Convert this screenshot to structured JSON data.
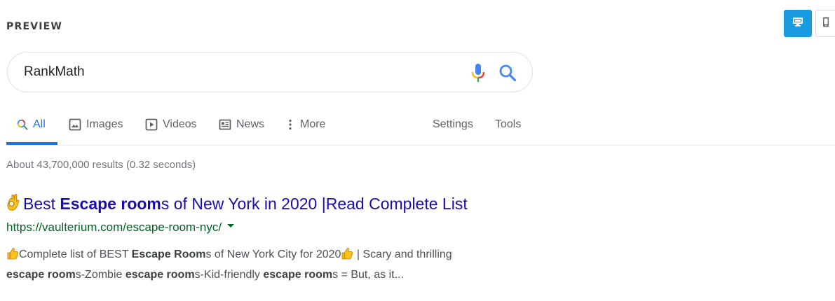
{
  "preview": {
    "label": "PREVIEW"
  },
  "device_toggle": {
    "desktop_icon": "desktop-icon",
    "mobile_icon": "mobile-icon",
    "active": "desktop"
  },
  "search": {
    "query": "RankMath",
    "mic_icon": "mic-icon",
    "search_icon": "search-icon"
  },
  "tabs": [
    {
      "label": "All",
      "icon": "search-icon",
      "active": true
    },
    {
      "label": "Images",
      "icon": "image-icon",
      "active": false
    },
    {
      "label": "Videos",
      "icon": "play-icon",
      "active": false
    },
    {
      "label": "News",
      "icon": "newspaper-icon",
      "active": false
    },
    {
      "label": "More",
      "icon": "vertical-dots-icon",
      "active": false
    },
    {
      "label": "Settings",
      "active": false
    },
    {
      "label": "Tools",
      "active": false
    }
  ],
  "results": {
    "stats": "About 43,700,000 results (0.32 seconds)",
    "items": [
      {
        "title_prefix": "Best ",
        "title_bold": "Escape room",
        "title_suffix": "s of New York in 2020 |Read Complete List",
        "url": "https://vaulterium.com/escape-room-nyc/",
        "snippet": {
          "p1": "Complete list of BEST ",
          "b1": "Escape Room",
          "p2": "s of New York City for 2020",
          "p3": " | Scary and thrilling",
          "b2": "escape room",
          "p4": "s-Zombie ",
          "b3": "escape room",
          "p5": "s-Kid-friendly ",
          "b4": "escape room",
          "p6": "s = But, as it..."
        }
      }
    ]
  },
  "colors": {
    "accent": "#1a73e8",
    "title_link": "#1a0dab",
    "url_green": "#006621",
    "toggle_active": "#1a9ae0"
  }
}
